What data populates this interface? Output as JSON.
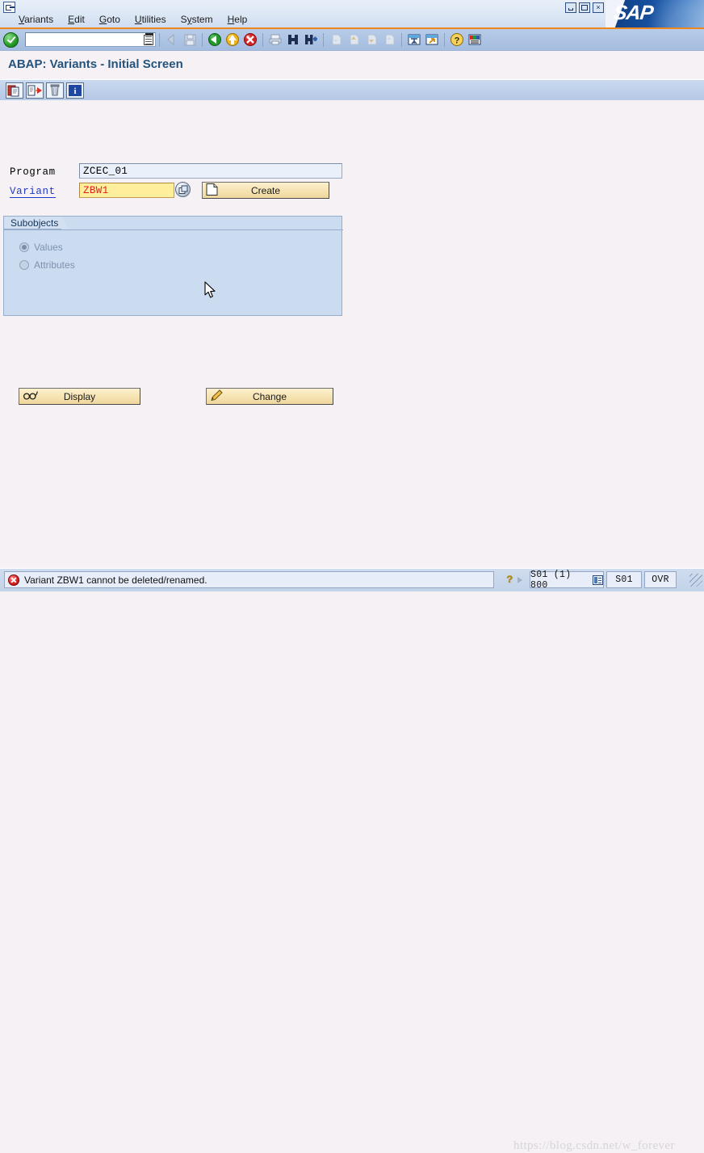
{
  "window": {
    "system_icon": "sap-session-icon",
    "controls": [
      {
        "name": "minimize-button",
        "glyph": ""
      },
      {
        "name": "maximize-button",
        "glyph": ""
      },
      {
        "name": "close-button",
        "glyph": "×"
      }
    ],
    "logo_text": "SAP"
  },
  "menubar": {
    "items": [
      {
        "label": "Variants",
        "accel": "V"
      },
      {
        "label": "Edit",
        "accel": "E"
      },
      {
        "label": "Goto",
        "accel": "G"
      },
      {
        "label": "Utilities",
        "accel": "U"
      },
      {
        "label": "System",
        "accel": "y"
      },
      {
        "label": "Help",
        "accel": "H"
      }
    ]
  },
  "toolbar": {
    "enter_button": "enter-checkmark",
    "command_field": {
      "value": "",
      "placeholder": ""
    },
    "icons": [
      "back-arrow-icon",
      "save-icon",
      "back-green-icon",
      "exit-yellow-icon",
      "cancel-red-icon",
      "print-icon",
      "find-icon",
      "find-next-icon",
      "first-page-icon",
      "previous-page-icon",
      "next-page-icon",
      "last-page-icon",
      "create-session-icon",
      "create-shortcut-icon",
      "help-icon",
      "customize-layout-icon"
    ]
  },
  "title": "ABAP: Variants - Initial Screen",
  "app_toolbar": {
    "icons": [
      "copy-icon",
      "rename-icon",
      "delete-icon",
      "info-icon"
    ]
  },
  "form": {
    "program_label": "Program",
    "program_value": "ZCEC_01",
    "variant_label": "Variant",
    "variant_value": "ZBW1",
    "f4_help": "search-help-icon",
    "create_button": "Create"
  },
  "subobjects": {
    "group_title": "Subobjects",
    "options": [
      {
        "label": "Values",
        "selected": true,
        "enabled": false
      },
      {
        "label": "Attributes",
        "selected": false,
        "enabled": false
      }
    ],
    "display_button": "Display",
    "change_button": "Change"
  },
  "statusbar": {
    "message": "Variant ZBW1 cannot be deleted/renamed.",
    "message_type": "error",
    "help_glyph": "❓",
    "system": "S01 (1) 800",
    "server": "S01",
    "mode": "OVR",
    "watermark": "https://blog.csdn.net/w_forever"
  },
  "colors": {
    "accent_orange": "#f0861e",
    "title_blue": "#24547e",
    "link_blue": "#2036c8",
    "variant_text_red": "#dd2020",
    "variant_bg_yellow": "#ffef9c",
    "button_tan": "#f6e3b2",
    "group_bg": "#ccdcf0",
    "canvas_bg": "#f6f1f4",
    "error_red": "#e02222"
  }
}
